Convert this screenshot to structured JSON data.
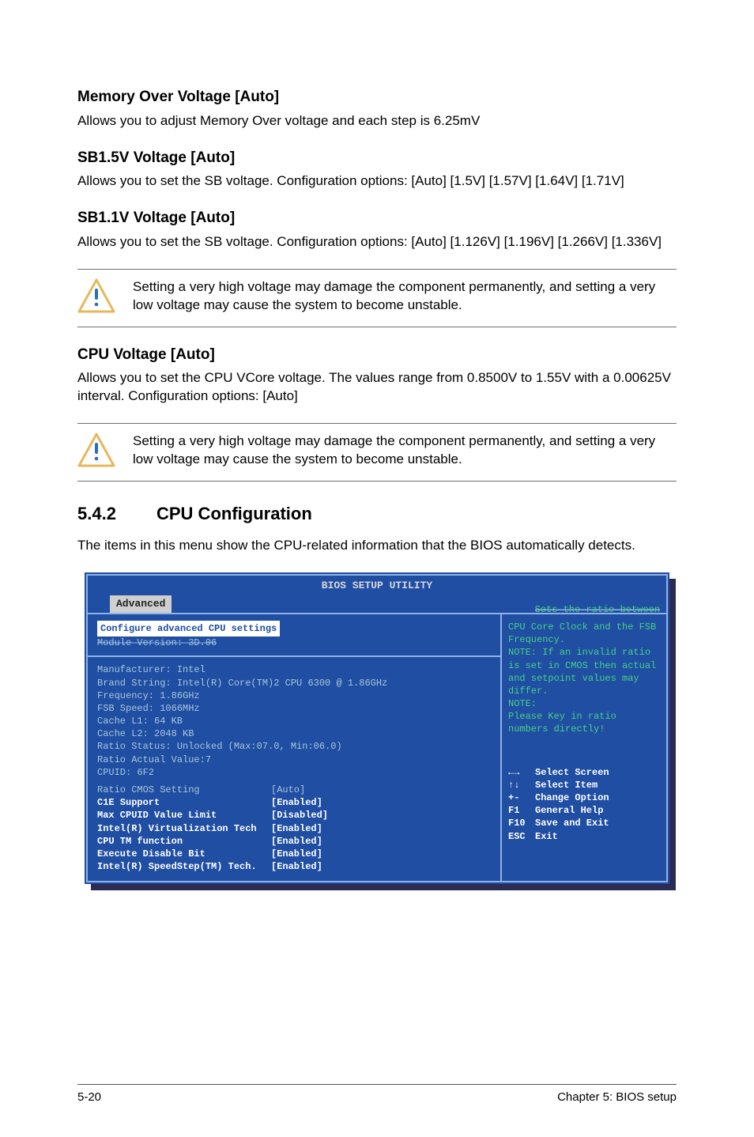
{
  "sections": {
    "memOver": {
      "title": "Memory Over Voltage [Auto]",
      "body": "Allows you to adjust Memory Over voltage and each step is 6.25mV"
    },
    "sb15": {
      "title": "SB1.5V Voltage [Auto]",
      "body": "Allows you to set the SB voltage. Configuration options: [Auto] [1.5V] [1.57V] [1.64V] [1.71V]"
    },
    "sb11": {
      "title": "SB1.1V Voltage [Auto]",
      "body": "Allows you to set the SB voltage. Configuration options: [Auto] [1.126V] [1.196V] [1.266V] [1.336V]"
    },
    "cpuV": {
      "title": "CPU Voltage [Auto]",
      "body": "Allows you to set the CPU VCore voltage. The values range from 0.8500V to 1.55V with a 0.00625V interval. Configuration options: [Auto]"
    }
  },
  "warn": "Setting a very high voltage may damage the component permanently, and setting a very low voltage may cause the system to become unstable.",
  "chapter": {
    "num": "5.4.2",
    "title": "CPU Configuration",
    "intro": "The items in this menu show the CPU-related information that the BIOS automatically detects."
  },
  "bios": {
    "title": "BIOS SETUP UTILITY",
    "tab": "Advanced",
    "configHead": "Configure advanced CPU settings",
    "module": "Module Version: 3D.06",
    "info": [
      "Manufacturer: Intel",
      "Brand String: Intel(R) Core(TM)2 CPU 6300 @ 1.86GHz",
      "Frequency:    1.86GHz",
      "FSB Speed:    1066MHz",
      "Cache L1:       64 KB",
      "Cache L2:     2048 KB",
      "Ratio Status: Unlocked (Max:07.0, Min:06.0)",
      "Ratio Actual Value:7",
      "CPUID:          6F2"
    ],
    "settings": [
      {
        "label": "Ratio CMOS Setting",
        "value": "[Auto]"
      },
      {
        "label": "C1E Support",
        "value": "[Enabled]"
      },
      {
        "label": "Max CPUID Value Limit",
        "value": "[Disabled]"
      },
      {
        "label": "Intel(R) Virtualization Tech",
        "value": "[Enabled]"
      },
      {
        "label": "CPU TM function",
        "value": "[Enabled]"
      },
      {
        "label": "Execute Disable Bit",
        "value": "[Enabled]"
      },
      {
        "label": "Intel(R) SpeedStep(TM) Tech.",
        "value": "[Enabled]"
      }
    ],
    "helpTop": "Sets the ratio between",
    "help": "CPU Core Clock and the FSB Frequency.\nNOTE: If an invalid ratio is set in CMOS then actual and setpoint values may differ.\nNOTE:\nPlease Key in ratio numbers directly!",
    "nav": [
      {
        "key": "←→",
        "label": "Select Screen"
      },
      {
        "key": "↑↓",
        "label": "Select Item"
      },
      {
        "key": "+-",
        "label": "Change Option"
      },
      {
        "key": "F1",
        "label": "General Help"
      },
      {
        "key": "F10",
        "label": "Save and Exit"
      },
      {
        "key": "ESC",
        "label": "Exit"
      }
    ]
  },
  "footer": {
    "left": "5-20",
    "right": "Chapter 5: BIOS setup"
  }
}
